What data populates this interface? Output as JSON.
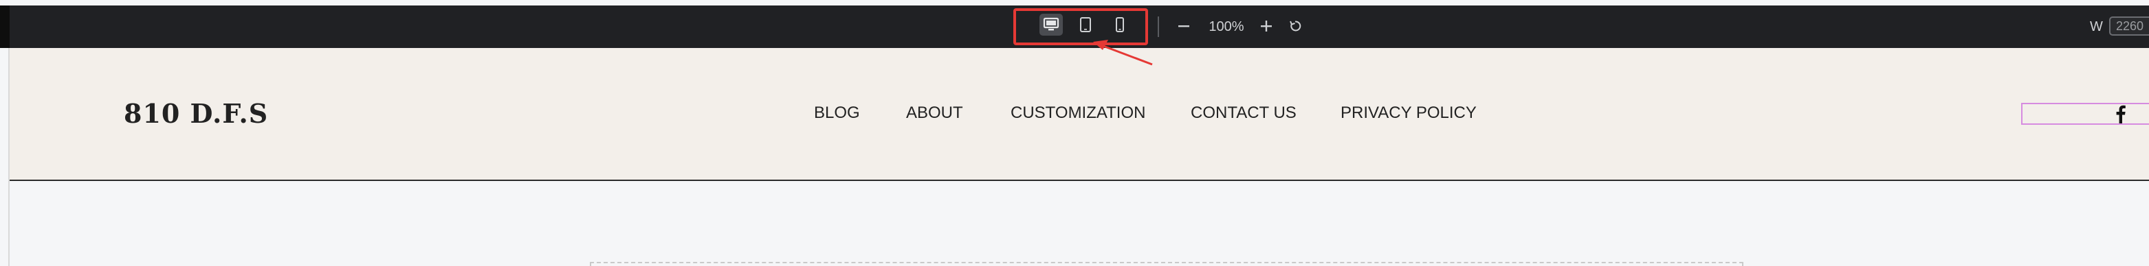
{
  "toolbar": {
    "devices": [
      {
        "name": "desktop",
        "icon": "desktop-icon",
        "active": true
      },
      {
        "name": "tablet",
        "icon": "tablet-icon",
        "active": false
      },
      {
        "name": "mobile",
        "icon": "mobile-icon",
        "active": false
      }
    ],
    "zoom_level": "100%",
    "zoom_out_icon": "minus-icon",
    "zoom_in_icon": "plus-icon",
    "reset_icon": "reset-icon",
    "width_label": "W",
    "width_value": "2260"
  },
  "site_header": {
    "logo": "810 D.F.S",
    "nav": [
      "BLOG",
      "ABOUT",
      "CUSTOMIZATION",
      "CONTACT US",
      "PRIVACY POLICY"
    ],
    "social_icon": "facebook-icon"
  },
  "colors": {
    "toolbar_bg": "#202124",
    "header_bg": "#f3efea",
    "highlight": "#e53935",
    "selection": "#d68be0"
  }
}
